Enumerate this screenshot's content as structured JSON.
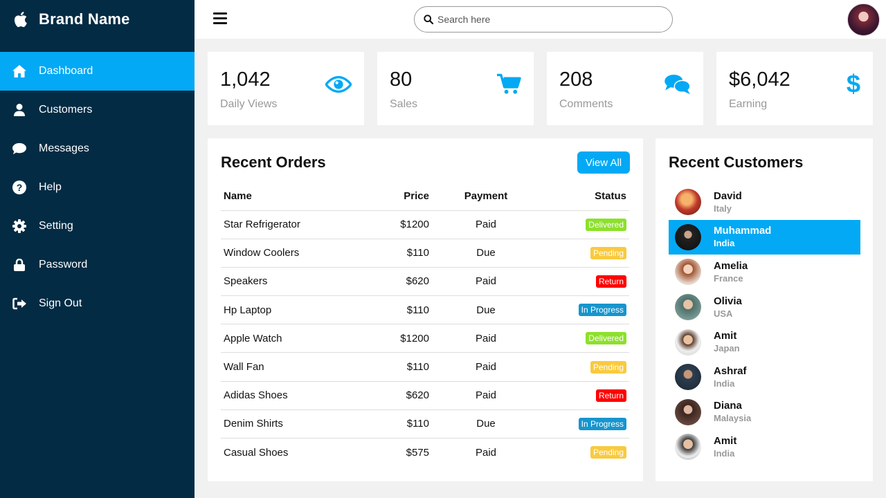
{
  "brand": {
    "name": "Brand Name",
    "logo_icon": "apple-icon"
  },
  "sidebar": {
    "items": [
      {
        "label": "Dashboard",
        "icon": "home-icon",
        "active": true
      },
      {
        "label": "Customers",
        "icon": "user-icon",
        "active": false
      },
      {
        "label": "Messages",
        "icon": "chat-icon",
        "active": false
      },
      {
        "label": "Help",
        "icon": "help-icon",
        "active": false
      },
      {
        "label": "Setting",
        "icon": "gear-icon",
        "active": false
      },
      {
        "label": "Password",
        "icon": "lock-icon",
        "active": false
      },
      {
        "label": "Sign Out",
        "icon": "sign-out-icon",
        "active": false
      }
    ]
  },
  "topbar": {
    "search_placeholder": "Search here"
  },
  "cards": [
    {
      "value": "1,042",
      "label": "Daily Views",
      "icon": "eye-icon"
    },
    {
      "value": "80",
      "label": "Sales",
      "icon": "cart-icon"
    },
    {
      "value": "208",
      "label": "Comments",
      "icon": "comments-icon"
    },
    {
      "value": "$6,042",
      "label": "Earning",
      "icon": "dollar-icon"
    }
  ],
  "orders": {
    "title": "Recent Orders",
    "view_all": "View All",
    "columns": [
      "Name",
      "Price",
      "Payment",
      "Status"
    ],
    "rows": [
      {
        "name": "Star Refrigerator",
        "price": "$1200",
        "payment": "Paid",
        "status": "Delivered"
      },
      {
        "name": "Window Coolers",
        "price": "$110",
        "payment": "Due",
        "status": "Pending"
      },
      {
        "name": "Speakers",
        "price": "$620",
        "payment": "Paid",
        "status": "Return"
      },
      {
        "name": "Hp Laptop",
        "price": "$110",
        "payment": "Due",
        "status": "In Progress"
      },
      {
        "name": "Apple Watch",
        "price": "$1200",
        "payment": "Paid",
        "status": "Delivered"
      },
      {
        "name": "Wall Fan",
        "price": "$110",
        "payment": "Paid",
        "status": "Pending"
      },
      {
        "name": "Adidas Shoes",
        "price": "$620",
        "payment": "Paid",
        "status": "Return"
      },
      {
        "name": "Denim Shirts",
        "price": "$110",
        "payment": "Due",
        "status": "In Progress"
      },
      {
        "name": "Casual Shoes",
        "price": "$575",
        "payment": "Paid",
        "status": "Pending"
      }
    ]
  },
  "customers": {
    "title": "Recent Customers",
    "items": [
      {
        "name": "David",
        "country": "Italy",
        "active": false
      },
      {
        "name": "Muhammad",
        "country": "India",
        "active": true
      },
      {
        "name": "Amelia",
        "country": "France",
        "active": false
      },
      {
        "name": "Olivia",
        "country": "USA",
        "active": false
      },
      {
        "name": "Amit",
        "country": "Japan",
        "active": false
      },
      {
        "name": "Ashraf",
        "country": "India",
        "active": false
      },
      {
        "name": "Diana",
        "country": "Malaysia",
        "active": false
      },
      {
        "name": "Amit",
        "country": "India",
        "active": false
      }
    ]
  },
  "colors": {
    "sidebar": "#032b44",
    "accent": "#03a9f4",
    "delivered": "#8de02c",
    "pending": "#f9ca3f",
    "return": "#ff0000",
    "in_progress": "#1795ce"
  }
}
